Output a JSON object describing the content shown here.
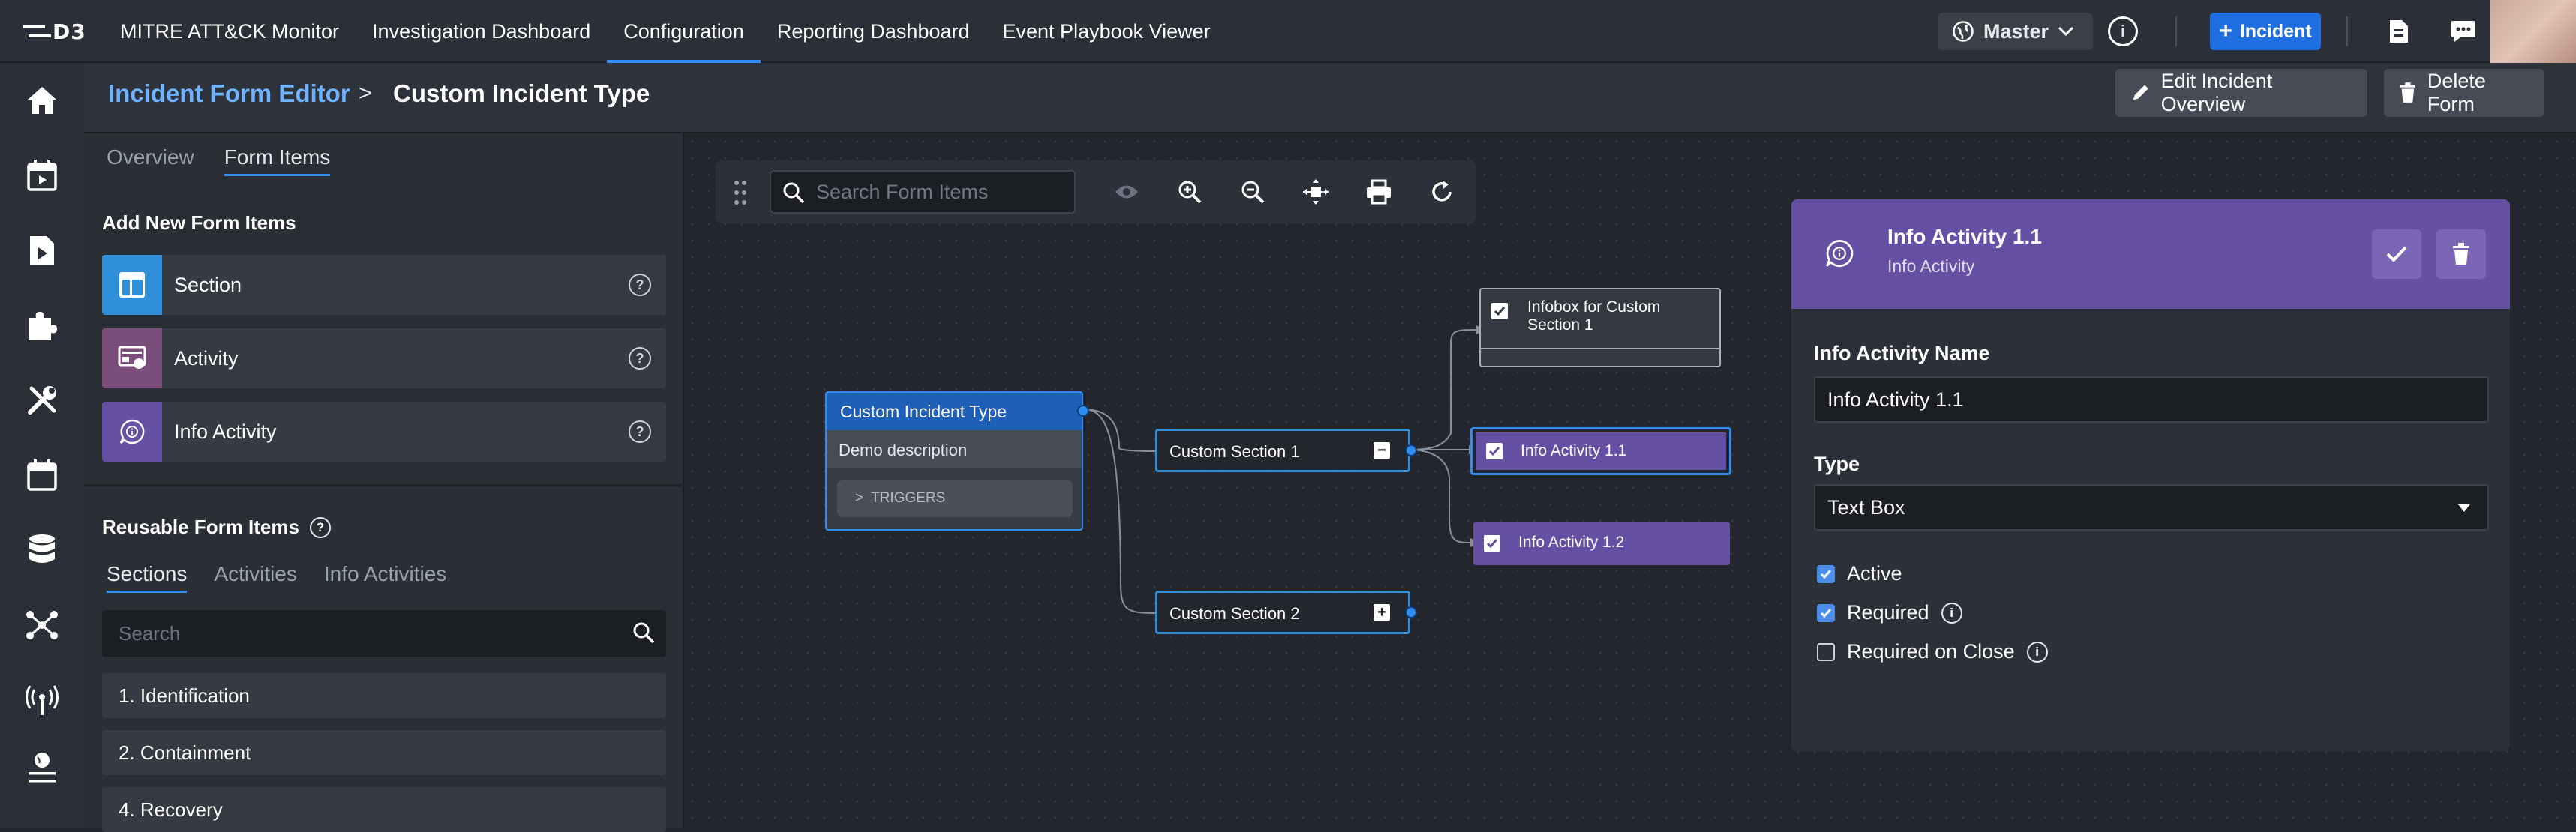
{
  "app": {
    "logo_text": "D3",
    "nav": [
      "MITRE ATT&CK Monitor",
      "Investigation Dashboard",
      "Configuration",
      "Reporting Dashboard",
      "Event Playbook Viewer"
    ],
    "master_label": "Master",
    "incident_label": "Incident"
  },
  "header": {
    "breadcrumb_parent": "Incident Form Editor",
    "breadcrumb_separator": ">",
    "title": "Custom Incident Type",
    "edit_overview_label": "Edit Incident Overview",
    "delete_form_label": "Delete Form"
  },
  "left_panel": {
    "tabs": [
      "Overview",
      "Form Items"
    ],
    "add_title": "Add New Form Items",
    "add_items": [
      {
        "label": "Section",
        "color": "#2f8fd8"
      },
      {
        "label": "Activity",
        "color": "#7b4d7a"
      },
      {
        "label": "Info Activity",
        "color": "#6650a4"
      }
    ],
    "reusable_title": "Reusable Form Items",
    "reusable_tabs": [
      "Sections",
      "Activities",
      "Info Activities"
    ],
    "search_placeholder": "Search",
    "reusable_items": [
      "1. Identification",
      "2. Containment",
      "4. Recovery"
    ]
  },
  "canvas": {
    "search_placeholder": "Search Form Items",
    "root": {
      "title": "Custom Incident Type",
      "description": "Demo description",
      "triggers_label": "TRIGGERS",
      "triggers_chevron": ">"
    },
    "sections": [
      "Custom Section 1",
      "Custom Section 2"
    ],
    "collapse_symbol": "−",
    "expand_symbol": "+",
    "infobox": "Infobox for Custom Section 1",
    "activities": [
      "Info Activity 1.1",
      "Info Activity 1.2"
    ]
  },
  "details": {
    "title": "Info Activity 1.1",
    "subtitle": "Info Activity",
    "name_label": "Info Activity Name",
    "name_value": "Info Activity 1.1",
    "type_label": "Type",
    "type_value": "Text Box",
    "checkboxes": [
      {
        "label": "Active",
        "checked": true
      },
      {
        "label": "Required",
        "checked": true
      },
      {
        "label": "Required on Close",
        "checked": false
      }
    ],
    "info_glyph": "i"
  },
  "colors": {
    "accent": "#2f8df0",
    "info_activity": "#6650a4",
    "section_blue": "#2f8fd8"
  }
}
